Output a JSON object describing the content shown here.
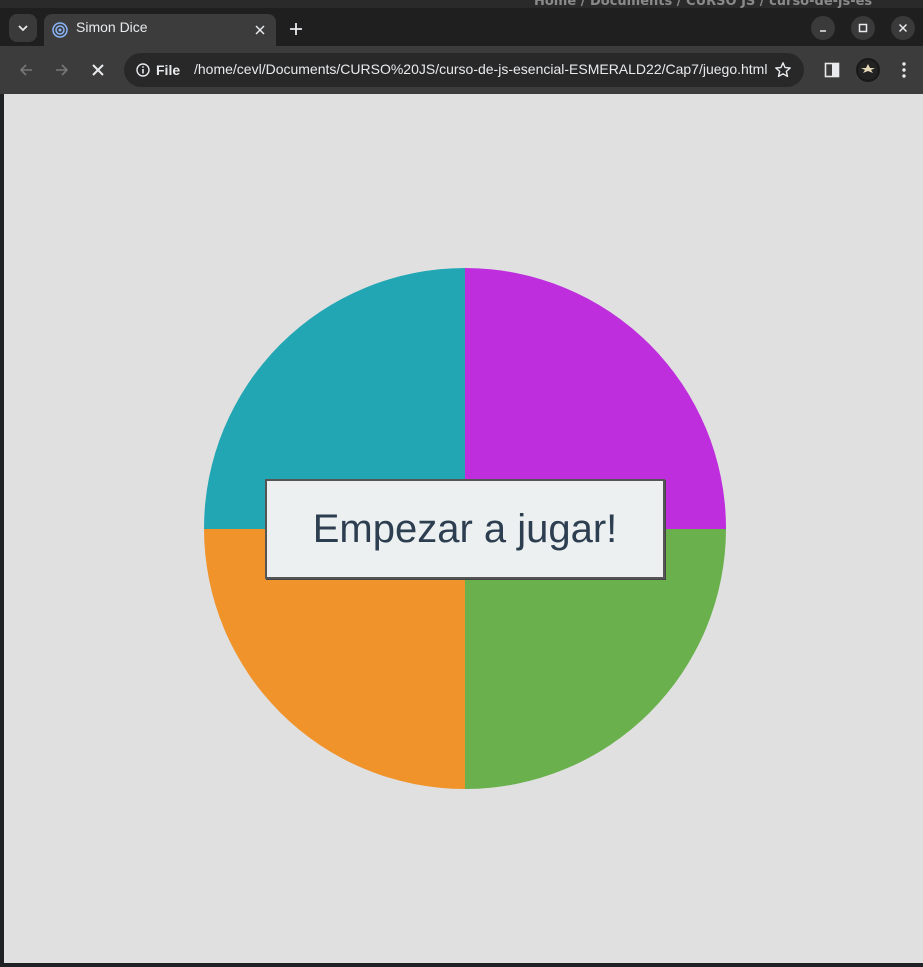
{
  "background_window": {
    "breadcrumbs": "Home  /  Documents  /  CURSO JS  /  curso-de-js-es"
  },
  "tab": {
    "title": "Simon Dice"
  },
  "toolbar": {
    "site_chip_label": "File",
    "url": "/home/cevl/Documents/CURSO%20JS/curso-de-js-esencial-ESMERALD22/Cap7/juego.html"
  },
  "game": {
    "colors": {
      "top_left": "#22a6b3",
      "top_right": "#be2edd",
      "bottom_left": "#f0932b",
      "bottom_right": "#6ab04c"
    },
    "start_button_label": "Empezar a jugar!"
  },
  "icons": [
    "tab-search-icon",
    "favicon-icon",
    "close-icon",
    "plus-icon",
    "minimize-icon",
    "maximize-icon",
    "window-close-icon",
    "back-arrow-icon",
    "forward-arrow-icon",
    "stop-loading-icon",
    "info-icon",
    "star-icon",
    "side-panel-icon",
    "profile-avatar",
    "kebab-menu-icon"
  ]
}
